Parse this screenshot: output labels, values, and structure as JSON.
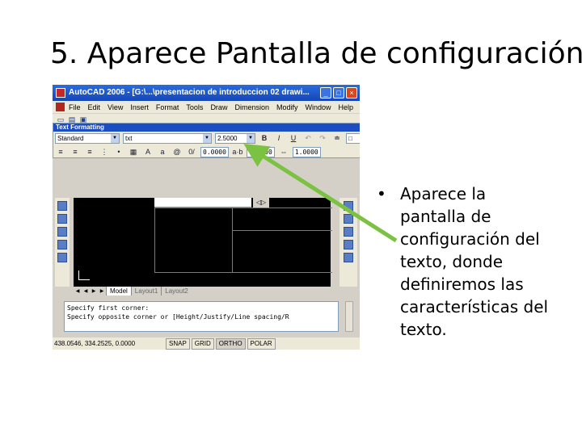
{
  "slide": {
    "title": "5. Aparece Pantalla de configuración",
    "bullet_marker": "•",
    "bullet_text": "Aparece la\npantalla de\nconfiguración del\ntexto, donde\ndefiniremos las\ncaracterísticas del\ntexto.",
    "arrow_color": "#7cc242"
  },
  "autocad": {
    "window_title": "AutoCAD 2006 - [G:\\...\\presentacion de introduccion 02 drawi...",
    "window_buttons": [
      "_",
      "□",
      "×"
    ],
    "menu_items": [
      "File",
      "Edit",
      "View",
      "Insert",
      "Format",
      "Tools",
      "Draw",
      "Dimension",
      "Modify",
      "Window",
      "Help"
    ],
    "text_formatting": {
      "header": "Text Formatting",
      "style_value": "Standard",
      "font_value": "txt",
      "height_value": "2.5000",
      "ok_label": "OK",
      "oblique_value": "0.0000",
      "tracking_value": "1.0000",
      "width_value": "1.0000",
      "format_icons": [
        "bold-icon",
        "italic-icon",
        "underline-icon",
        "undo-icon",
        "redo-icon",
        "stack-icon",
        "color-icon"
      ]
    },
    "layout_tabs": [
      "Model",
      "Layout1",
      "Layout2"
    ],
    "command_lines": [
      "Specify first corner:",
      "Specify opposite corner or [Height/Justify/Line spacing/R"
    ],
    "status": {
      "coords": "438.0546, 334.2525, 0.0000",
      "buttons": [
        "SNAP",
        "GRID",
        "ORTHO",
        "POLAR"
      ]
    },
    "colors": {
      "titlebar": "#1a4ec2",
      "canvas": "#000000",
      "drawing_lines": "#2fae2f"
    }
  }
}
